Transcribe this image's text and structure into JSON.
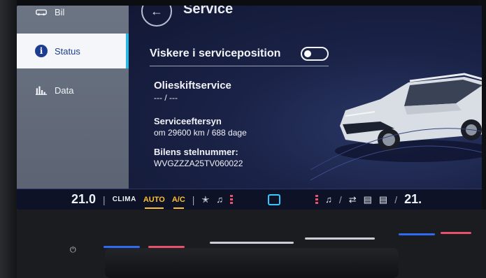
{
  "sidebar": {
    "items": [
      {
        "label": "Bil",
        "icon": "car-icon"
      },
      {
        "label": "Status",
        "icon": "info-icon",
        "active": true
      },
      {
        "label": "Data",
        "icon": "bar-chart-icon"
      }
    ]
  },
  "header": {
    "title": "Service"
  },
  "wiper": {
    "label": "Viskere i serviceposition",
    "on": false
  },
  "oil": {
    "title": "Olieskiftservice",
    "value": "--- / ---"
  },
  "inspection": {
    "title": "Serviceeftersyn",
    "value": "om 29600 km / 688 dage"
  },
  "vin": {
    "title": "Bilens stelnummer:",
    "value": "WVGZZZA25TV060022"
  },
  "clima": {
    "temp_left": "21.0",
    "clima_label": "CLIMA",
    "auto_label": "AUTO",
    "ac_label": "A/C",
    "temp_right": "21.",
    "sep": "|",
    "sep2": "/"
  },
  "colors": {
    "accent": "#2fb7e6",
    "auto": "#ffbf2e",
    "heat": "#e8506c",
    "cool": "#2f6bf2"
  }
}
